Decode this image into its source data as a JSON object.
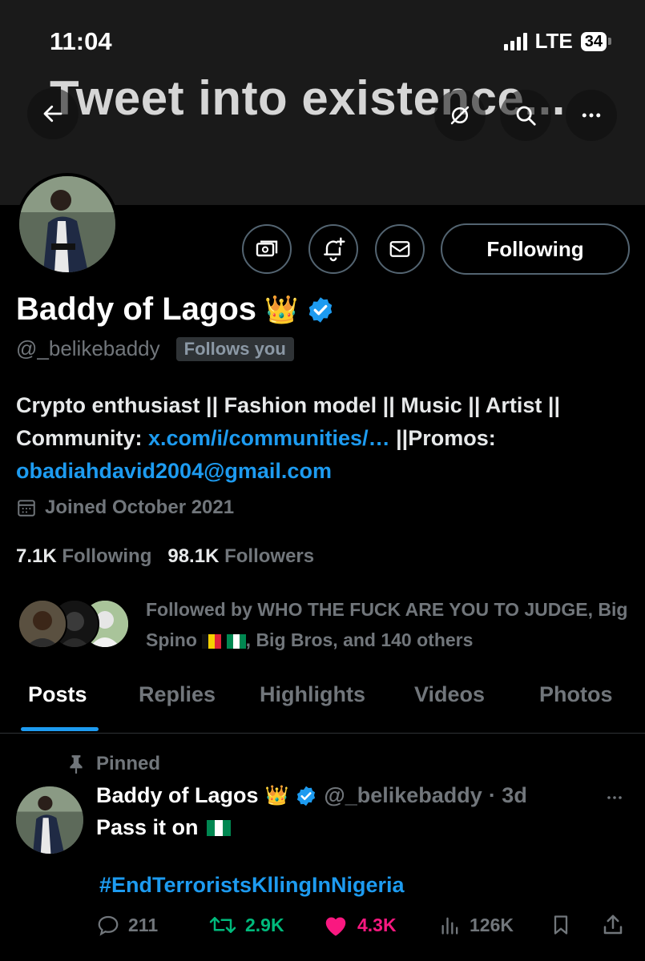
{
  "status_bar": {
    "time": "11:04",
    "network": "LTE",
    "battery": "34"
  },
  "banner": {
    "title": "Tweet into existence..."
  },
  "profile": {
    "name": "Baddy of Lagos",
    "name_emoji": "👑",
    "handle": "@_belikebaddy",
    "follows_you": "Follows you",
    "follow_button": "Following",
    "bio_part1": "Crypto enthusiast || Fashion model || Music || Artist || Community: ",
    "bio_link": "x.com/i/communities/…",
    "bio_part2": " ||Promos: ",
    "bio_email": "obadiahdavid2004@gmail.com",
    "joined": "Joined October 2021",
    "following_count": "7.1K",
    "following_label": "Following",
    "followers_count": "98.1K",
    "followers_label": "Followers",
    "followed_by_part1": "Followed by WHO THE FUCK ARE YOU TO JUDGE, Big Spino ",
    "followed_by_part2": ", Big Bros, and 140 others"
  },
  "tabs": [
    "Posts",
    "Replies",
    "Highlights",
    "Videos",
    "Photos"
  ],
  "pinned_tweet": {
    "pinned_label": "Pinned",
    "name": "Baddy of Lagos",
    "name_emoji": "👑",
    "handle": "@_belikebaddy",
    "time": "· 3d",
    "text": "Pass it on",
    "hashtag": "#EndTerroristsKllingInNigeria",
    "replies": "211",
    "reposts": "2.9K",
    "likes": "4.3K",
    "views": "126K"
  },
  "colors": {
    "accent": "#1d9bf0",
    "repost": "#00ba7c",
    "like": "#f91880",
    "muted": "#71767b"
  }
}
